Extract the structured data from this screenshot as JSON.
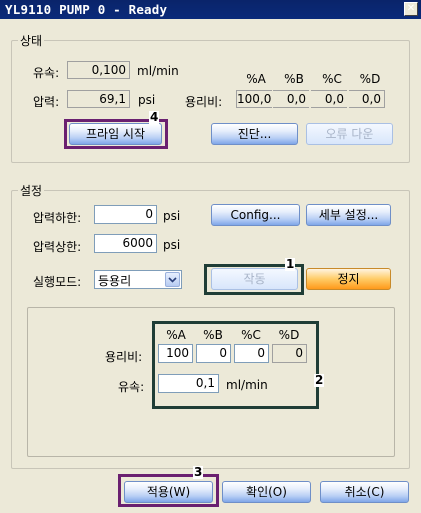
{
  "window": {
    "title": "YL9110 PUMP 0 - Ready",
    "close_glyph": "✕"
  },
  "status_group": {
    "label": "상태",
    "flow_label": "유속:",
    "flow_value": "0,100",
    "flow_unit": "ml/min",
    "pressure_label": "압력:",
    "pressure_value": "69,1",
    "pressure_unit": "psi",
    "ratio_label": "용리비:",
    "ratio_headers": [
      "%A",
      "%B",
      "%C",
      "%D"
    ],
    "ratio_values": [
      "100,0",
      "0,0",
      "0,0",
      "0,0"
    ],
    "prime_start_button": "프라임 시작",
    "diagnose_button": "진단...",
    "error_clear_button": "오류 다운"
  },
  "settings_group": {
    "label": "설정",
    "pressure_low_label": "압력하한:",
    "pressure_low_value": "0",
    "pressure_low_unit": "psi",
    "pressure_high_label": "압력상한:",
    "pressure_high_value": "6000",
    "pressure_high_unit": "psi",
    "config_button": "Config...",
    "detail_settings_button": "세부 설정...",
    "run_mode_label": "실행모드:",
    "run_mode_value": "등용리",
    "start_button": "작동",
    "stop_button": "정지",
    "ratio_label": "용리비:",
    "ratio_headers": [
      "%A",
      "%B",
      "%C",
      "%D"
    ],
    "ratio_values": [
      "100",
      "0",
      "0",
      "0"
    ],
    "flow_label": "유속:",
    "flow_value": "0,1",
    "flow_unit": "ml/min"
  },
  "footer": {
    "apply_button": "적용(W)",
    "ok_button": "확인(O)",
    "cancel_button": "취소(C)"
  },
  "callouts": {
    "c1": "1",
    "c2": "2",
    "c3": "3",
    "c4": "4"
  },
  "colors": {
    "titlebar": "#0a246a",
    "window_bg": "#ece9d8",
    "callout_dark": "#1f3d36",
    "callout_purple": "#6a2070",
    "stop_button": "#ff9a1a"
  }
}
